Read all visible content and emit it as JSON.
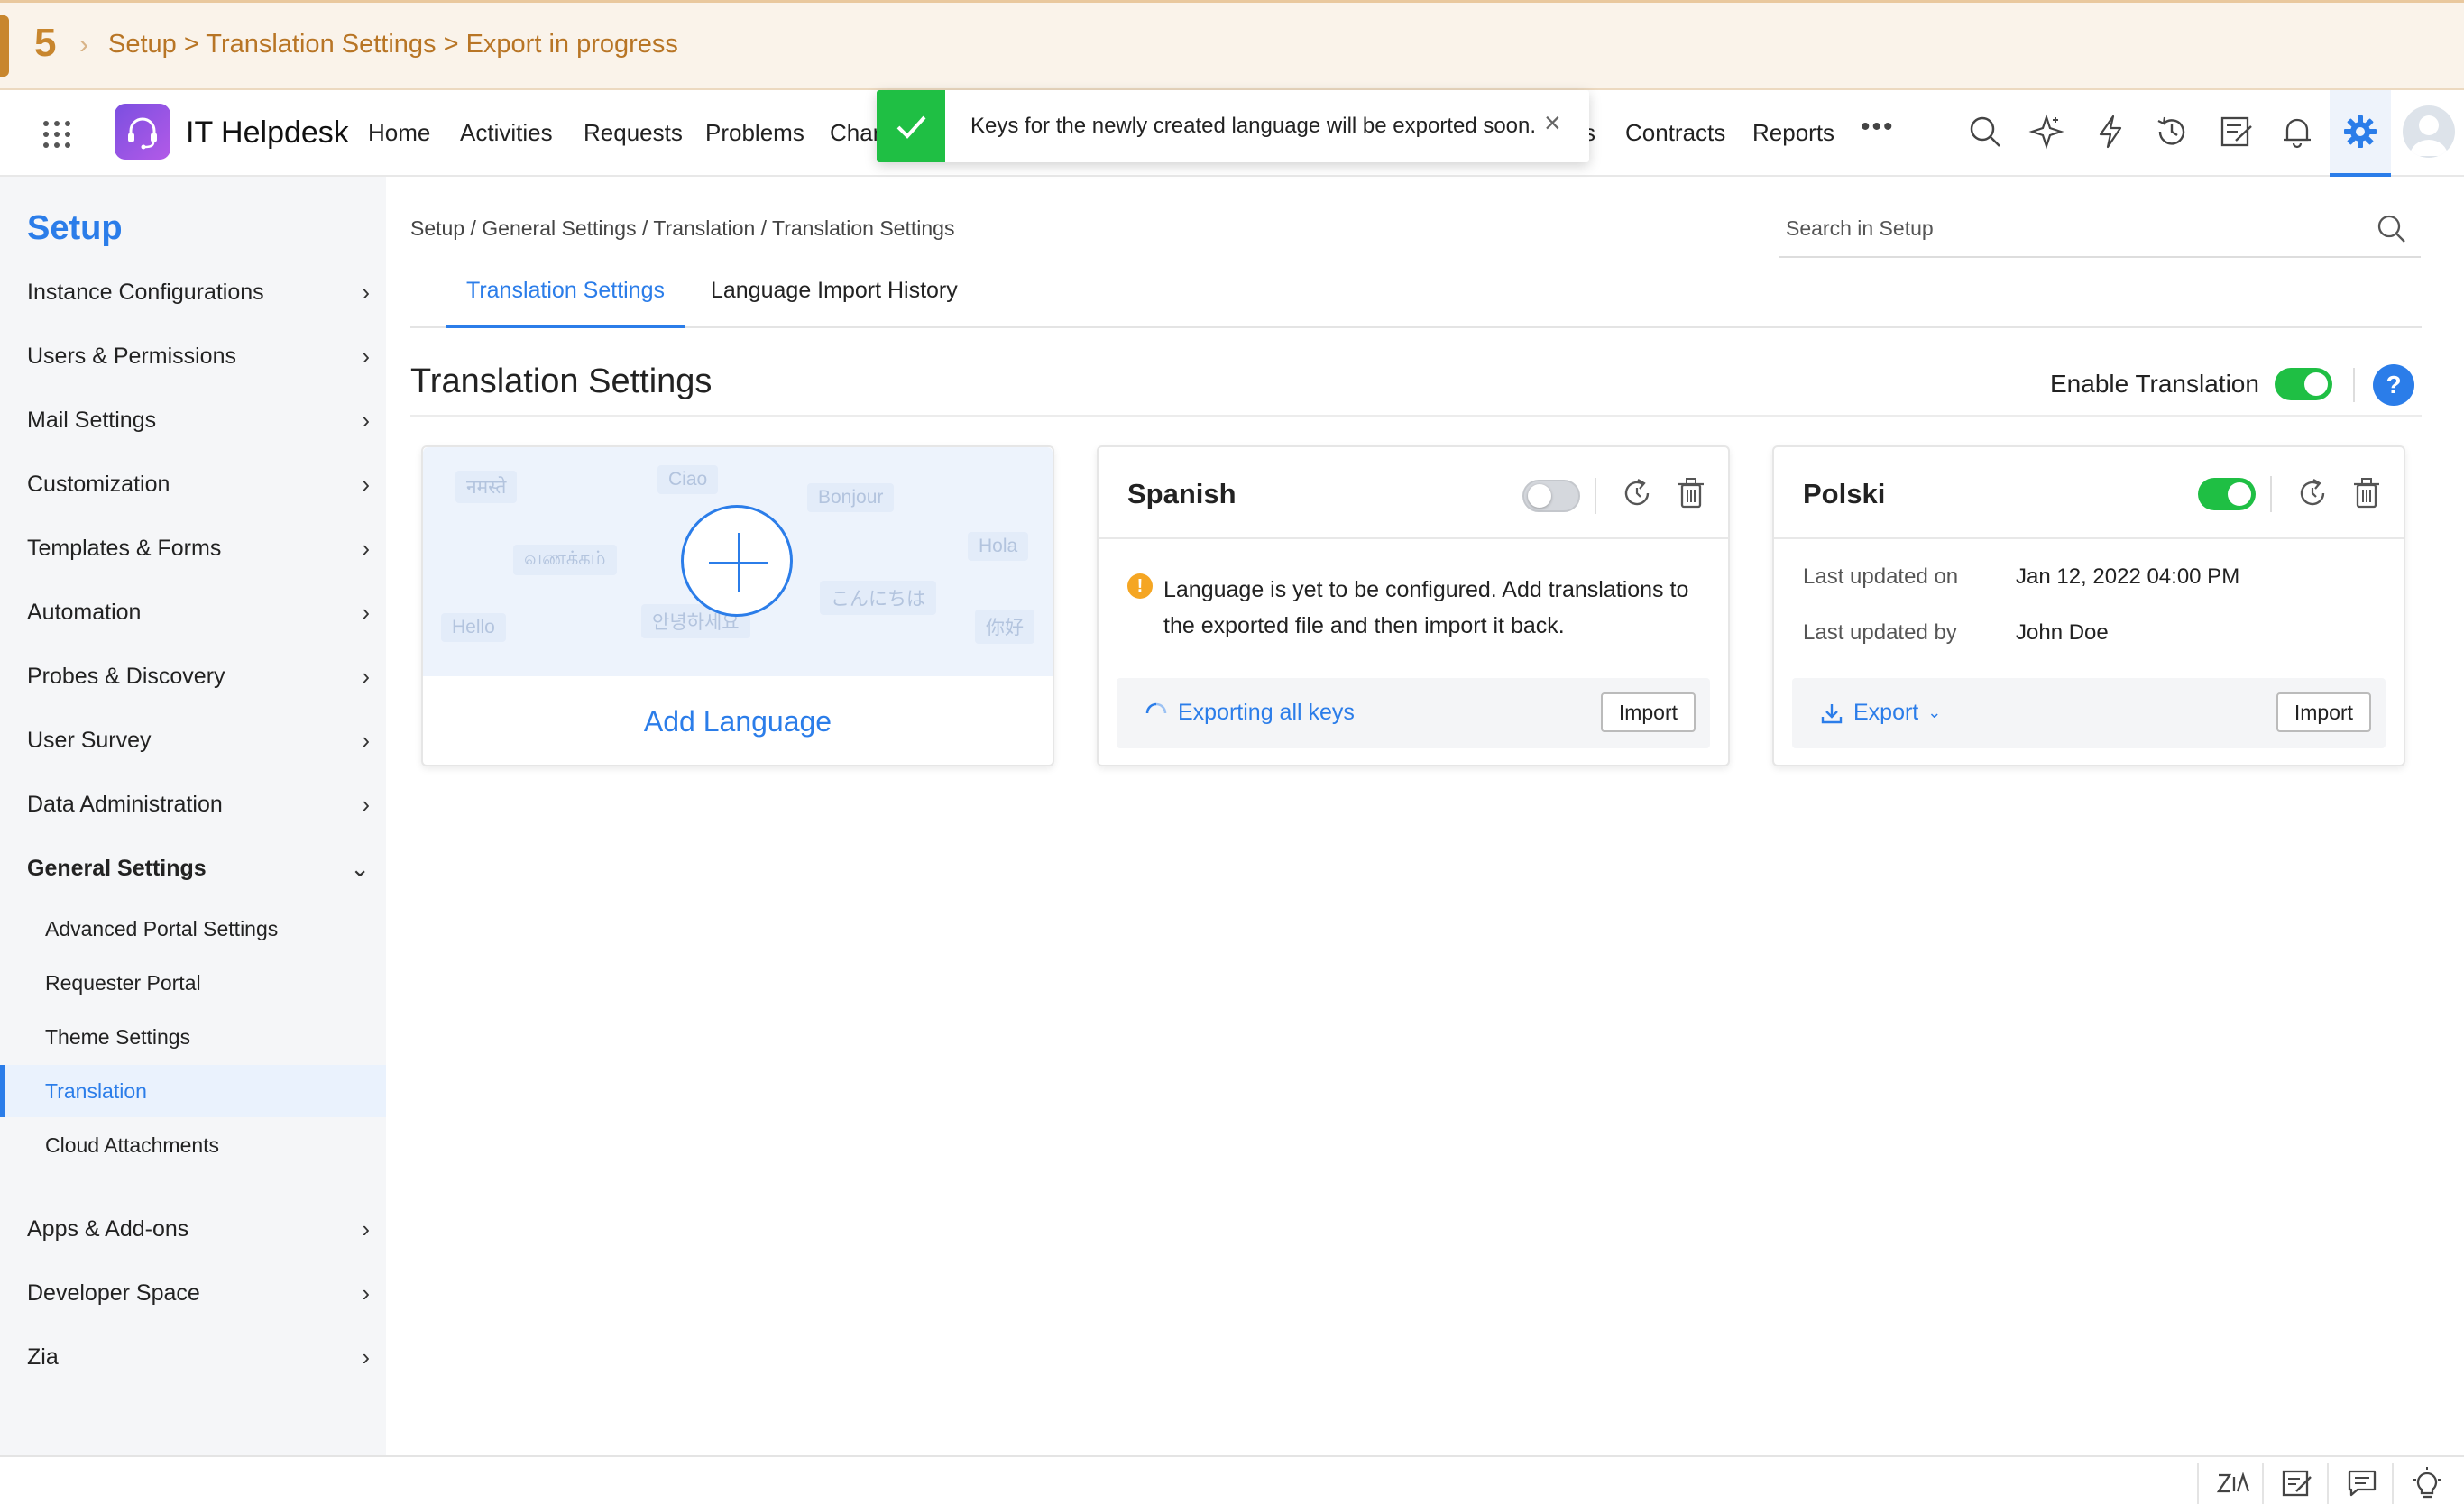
{
  "step": {
    "number": "5",
    "path": "Setup > Translation Settings > Export in progress"
  },
  "app": {
    "name": "IT Helpdesk"
  },
  "nav": {
    "links": [
      "Home",
      "Activities",
      "Requests",
      "Problems",
      "Char",
      "s",
      "Contracts",
      "Reports"
    ],
    "more": "•••"
  },
  "toast": {
    "message": "Keys for the newly created language will be exported soon.",
    "close": "×"
  },
  "sidebar": {
    "title": "Setup",
    "items": [
      {
        "label": "Instance Configurations",
        "chevron": "›"
      },
      {
        "label": "Users & Permissions",
        "chevron": "›"
      },
      {
        "label": "Mail Settings",
        "chevron": "›"
      },
      {
        "label": "Customization",
        "chevron": "›"
      },
      {
        "label": "Templates & Forms",
        "chevron": "›"
      },
      {
        "label": "Automation",
        "chevron": "›"
      },
      {
        "label": "Probes & Discovery",
        "chevron": "›"
      },
      {
        "label": "User Survey",
        "chevron": "›"
      },
      {
        "label": "Data Administration",
        "chevron": "›"
      },
      {
        "label": "General Settings",
        "chevron": "⌄"
      }
    ],
    "sub_items": [
      "Advanced Portal Settings",
      "Requester Portal",
      "Theme Settings",
      "Translation",
      "Cloud Attachments"
    ],
    "bottom_items": [
      {
        "label": "Apps & Add-ons",
        "chevron": "›"
      },
      {
        "label": "Developer Space",
        "chevron": "›"
      },
      {
        "label": "Zia",
        "chevron": "›"
      }
    ]
  },
  "breadcrumb": "Setup / General Settings / Translation / Translation Settings",
  "search": {
    "placeholder": "Search in Setup"
  },
  "tabs": [
    "Translation Settings",
    "Language Import History"
  ],
  "page": {
    "title": "Translation Settings",
    "enable_label": "Enable Translation",
    "help": "?"
  },
  "add_card": {
    "label": "Add Language",
    "bubbles": [
      "नमस्ते",
      "Ciao",
      "Bonjour",
      "Hola",
      "வணக்கம்",
      "こんにちは",
      "Hello",
      "안녕하세요",
      "你好"
    ]
  },
  "spanish_card": {
    "title": "Spanish",
    "warning": "Language is yet to be configured. Add translations to the exported file and then import it back.",
    "status": "Exporting all keys",
    "import": "Import"
  },
  "polski_card": {
    "title": "Polski",
    "updated_on_label": "Last updated on",
    "updated_on": "Jan 12, 2022 04:00 PM",
    "updated_by_label": "Last updated by",
    "updated_by": "John Doe",
    "export": "Export",
    "import": "Import"
  },
  "colors": {
    "accent": "#2b7de9",
    "success": "#1fbf44",
    "warning": "#f5a623",
    "step": "#c8862e"
  }
}
